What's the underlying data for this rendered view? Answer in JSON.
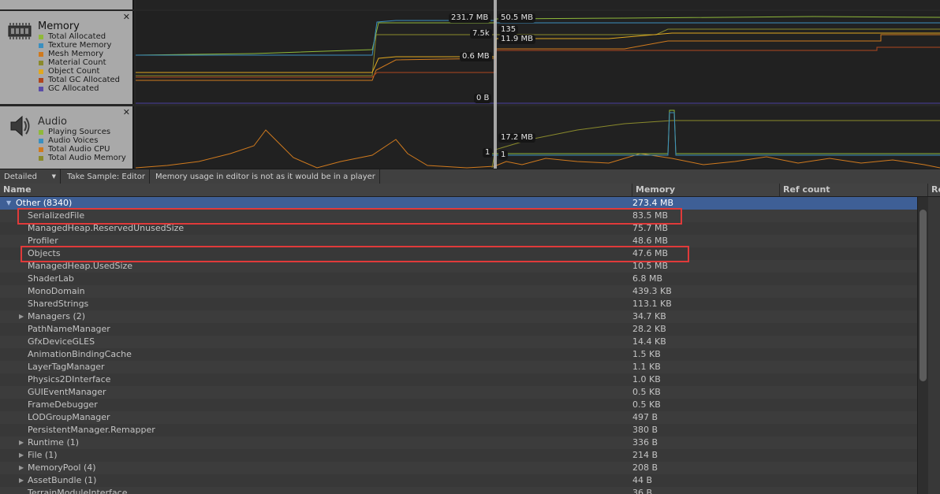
{
  "memory_lane": {
    "title": "Memory",
    "legend": [
      {
        "label": "Total Allocated",
        "color": "#8fb83a"
      },
      {
        "label": "Texture Memory",
        "color": "#3a8fc0"
      },
      {
        "label": "Mesh Memory",
        "color": "#d07a1e"
      },
      {
        "label": "Material Count",
        "color": "#8a8a2c"
      },
      {
        "label": "Object Count",
        "color": "#e0a820"
      },
      {
        "label": "Total GC Allocated",
        "color": "#b0461e"
      },
      {
        "label": "GC Allocated",
        "color": "#5a4ca8"
      }
    ],
    "value_labels": [
      "231.7 MB",
      "50.5 MB",
      "7.5k",
      "135",
      "11.9 MB",
      "0.6 MB",
      "0 B"
    ]
  },
  "audio_lane": {
    "title": "Audio",
    "legend": [
      {
        "label": "Playing Sources",
        "color": "#8fb83a"
      },
      {
        "label": "Audio Voices",
        "color": "#3a8fc0"
      },
      {
        "label": "Total Audio CPU",
        "color": "#d07a1e"
      },
      {
        "label": "Total Audio Memory",
        "color": "#8a8a2c"
      }
    ],
    "value_labels": [
      "17.2 MB",
      "1",
      "1"
    ]
  },
  "toolbar": {
    "mode": "Detailed",
    "take_sample": "Take Sample: Editor",
    "notice": "Memory usage in editor is not as it would be in a player"
  },
  "columns": {
    "name": "Name",
    "memory": "Memory",
    "ref_count": "Ref count",
    "referenced_by": "Re"
  },
  "rows": [
    {
      "name": "Other (8340)",
      "memory": "273.4 MB",
      "depth": 0,
      "expandable": true,
      "expanded": true,
      "selected": true
    },
    {
      "name": "SerializedFile",
      "memory": "83.5 MB",
      "depth": 1,
      "highlighted": true
    },
    {
      "name": "ManagedHeap.ReservedUnusedSize",
      "memory": "75.7 MB",
      "depth": 1
    },
    {
      "name": "Profiler",
      "memory": "48.6 MB",
      "depth": 1
    },
    {
      "name": "Objects",
      "memory": "47.6 MB",
      "depth": 1,
      "highlighted": true
    },
    {
      "name": "ManagedHeap.UsedSize",
      "memory": "10.5 MB",
      "depth": 1
    },
    {
      "name": "ShaderLab",
      "memory": "6.8 MB",
      "depth": 1
    },
    {
      "name": "MonoDomain",
      "memory": "439.3 KB",
      "depth": 1
    },
    {
      "name": "SharedStrings",
      "memory": "113.1 KB",
      "depth": 1
    },
    {
      "name": "Managers (2)",
      "memory": "34.7 KB",
      "depth": 1,
      "expandable": true
    },
    {
      "name": "PathNameManager",
      "memory": "28.2 KB",
      "depth": 1
    },
    {
      "name": "GfxDeviceGLES",
      "memory": "14.4 KB",
      "depth": 1
    },
    {
      "name": "AnimationBindingCache",
      "memory": "1.5 KB",
      "depth": 1
    },
    {
      "name": "LayerTagManager",
      "memory": "1.1 KB",
      "depth": 1
    },
    {
      "name": "Physics2DInterface",
      "memory": "1.0 KB",
      "depth": 1
    },
    {
      "name": "GUIEventManager",
      "memory": "0.5 KB",
      "depth": 1
    },
    {
      "name": "FrameDebugger",
      "memory": "0.5 KB",
      "depth": 1
    },
    {
      "name": "LODGroupManager",
      "memory": "497 B",
      "depth": 1
    },
    {
      "name": "PersistentManager.Remapper",
      "memory": "380 B",
      "depth": 1
    },
    {
      "name": "Runtime (1)",
      "memory": "336 B",
      "depth": 1,
      "expandable": true
    },
    {
      "name": "File (1)",
      "memory": "214 B",
      "depth": 1,
      "expandable": true
    },
    {
      "name": "MemoryPool (4)",
      "memory": "208 B",
      "depth": 1,
      "expandable": true
    },
    {
      "name": "AssetBundle (1)",
      "memory": "44 B",
      "depth": 1,
      "expandable": true
    },
    {
      "name": "TerrainModuleInterface",
      "memory": "36 B",
      "depth": 1
    }
  ],
  "colors": {
    "selection": "#3e5f96",
    "highlight_box": "#e03a3a"
  },
  "icons": {
    "memory_lane": "memory-chip-icon",
    "audio_lane": "speaker-icon",
    "close": "close-icon",
    "expand": "triangle-right-icon",
    "collapse": "triangle-down-icon",
    "dropdown": "dropdown-arrow-icon"
  }
}
